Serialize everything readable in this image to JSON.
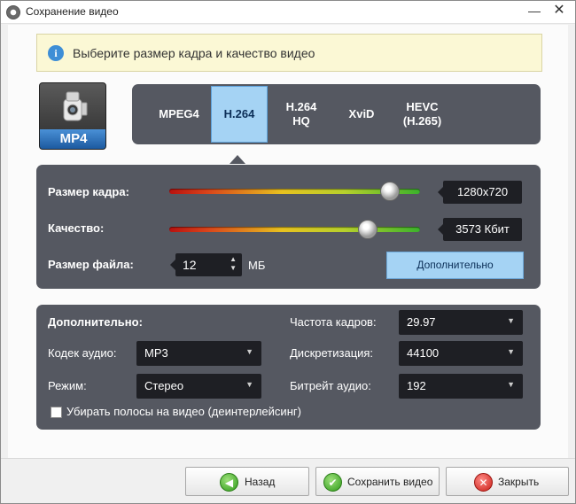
{
  "window": {
    "title": "Сохранение видео",
    "minimize_glyph": "—",
    "close_glyph": "✕"
  },
  "info": {
    "icon_glyph": "i",
    "text": "Выберите размер кадра и качество видео"
  },
  "format": {
    "label": "MP4",
    "icon": "video-camera-icon"
  },
  "codecs": [
    {
      "label": "MPEG4",
      "active": false
    },
    {
      "label": "H.264",
      "active": true
    },
    {
      "label": "H.264\nHQ",
      "active": false
    },
    {
      "label": "XviD",
      "active": false
    },
    {
      "label": "HEVC\n(H.265)",
      "active": false
    }
  ],
  "quality": {
    "frame_size_label": "Размер кадра:",
    "frame_size_value": "1280x720",
    "frame_size_level": 0.88,
    "quality_label": "Качество:",
    "quality_value": "3573 Кбит",
    "quality_level": 0.79,
    "file_size_label": "Размер файла:",
    "file_size_value": "12",
    "file_size_unit": "МБ",
    "advanced_button": "Дополнительно"
  },
  "extra": {
    "heading": "Дополнительно:",
    "audio_codec_label": "Кодек аудио:",
    "audio_codec_value": "MP3",
    "mode_label": "Режим:",
    "mode_value": "Стерео",
    "framerate_label": "Частота кадров:",
    "framerate_value": "29.97",
    "sampling_label": "Дискретизация:",
    "sampling_value": "44100",
    "audio_bitrate_label": "Битрейт аудио:",
    "audio_bitrate_value": "192",
    "deinterlace_label": "Убирать полосы на видео (деинтерлейсинг)",
    "deinterlace_checked": false
  },
  "footer": {
    "back": "Назад",
    "save": "Сохранить видео",
    "close": "Закрыть"
  },
  "colors": {
    "panel": "#555861",
    "accent": "#a5d3f4",
    "info_bg": "#fbf8d5"
  }
}
